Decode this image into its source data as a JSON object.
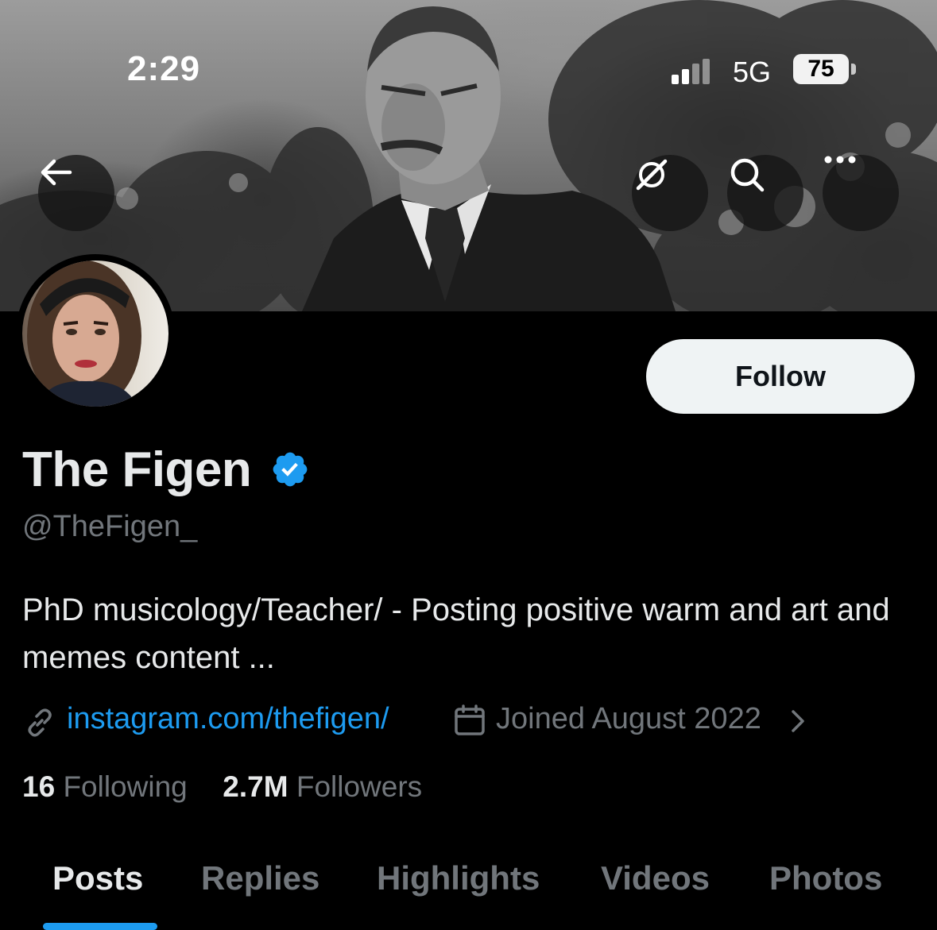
{
  "status_bar": {
    "time": "2:29",
    "network": "5G",
    "battery": "75"
  },
  "banner": {
    "description_icons": [
      "back-arrow-icon",
      "grok-icon",
      "search-icon",
      "more-icon"
    ]
  },
  "profile": {
    "display_name": "The Figen",
    "verified": true,
    "handle": "@TheFigen_",
    "bio": "PhD musicology/Teacher/  - Posting positive warm and art and memes content ...",
    "link_text": "instagram.com/thefigen/",
    "joined_text": "Joined August 2022",
    "following_count": "16",
    "following_label": "Following",
    "followers_count": "2.7M",
    "followers_label": "Followers"
  },
  "actions": {
    "follow_label": "Follow"
  },
  "tabs": [
    {
      "label": "Posts",
      "active": true
    },
    {
      "label": "Replies",
      "active": false
    },
    {
      "label": "Highlights",
      "active": false
    },
    {
      "label": "Videos",
      "active": false
    },
    {
      "label": "Photos",
      "active": false
    }
  ],
  "colors": {
    "background": "#000000",
    "primary_text": "#e7e9ea",
    "secondary_text": "#71767b",
    "link": "#1d9bf0",
    "verified_badge": "#1d9bf0",
    "follow_button_bg": "#eff3f4"
  }
}
